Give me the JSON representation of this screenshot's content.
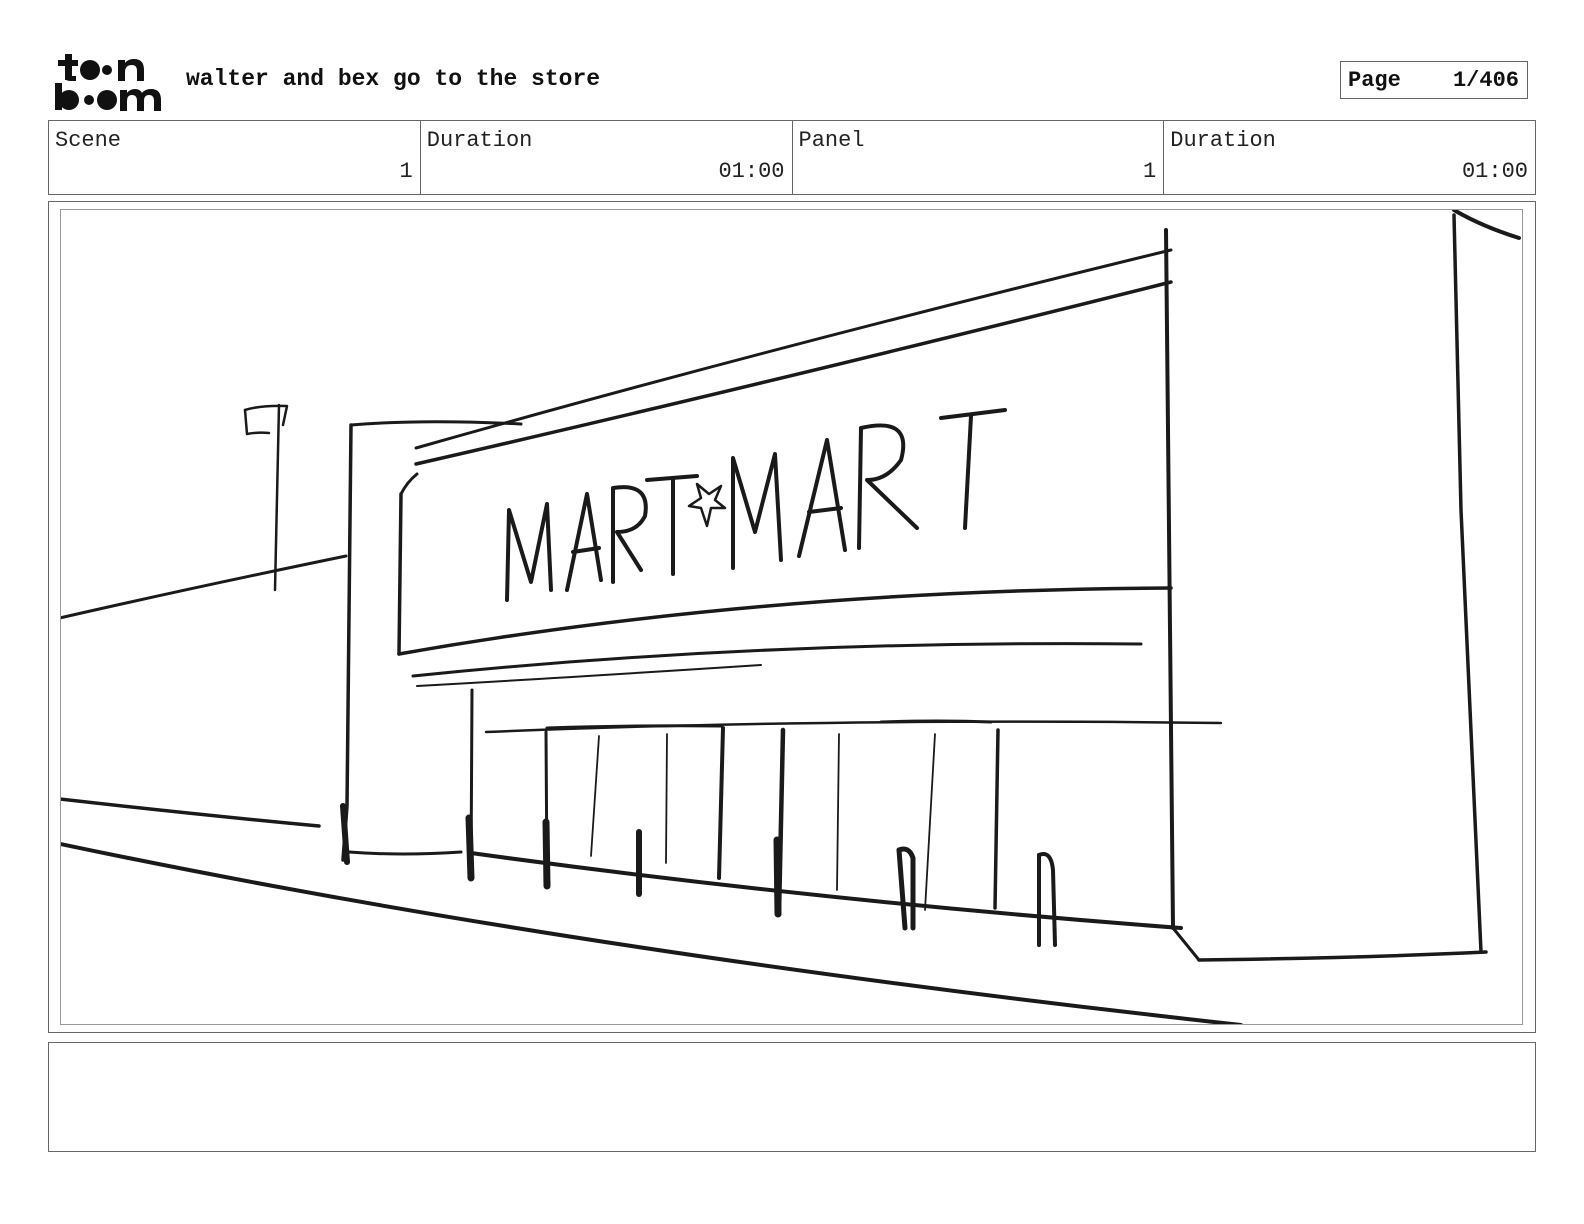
{
  "header": {
    "project_title": "walter and bex go to the store",
    "page_label": "Page",
    "page_value": "1/406"
  },
  "info": {
    "scene_label": "Scene",
    "scene_value": "1",
    "scene_duration_label": "Duration",
    "scene_duration_value": "01:00",
    "panel_label": "Panel",
    "panel_value": "1",
    "panel_duration_label": "Duration",
    "panel_duration_value": "01:00"
  },
  "panel": {
    "sign_text": "MART★MART"
  },
  "notes": {
    "text": ""
  }
}
